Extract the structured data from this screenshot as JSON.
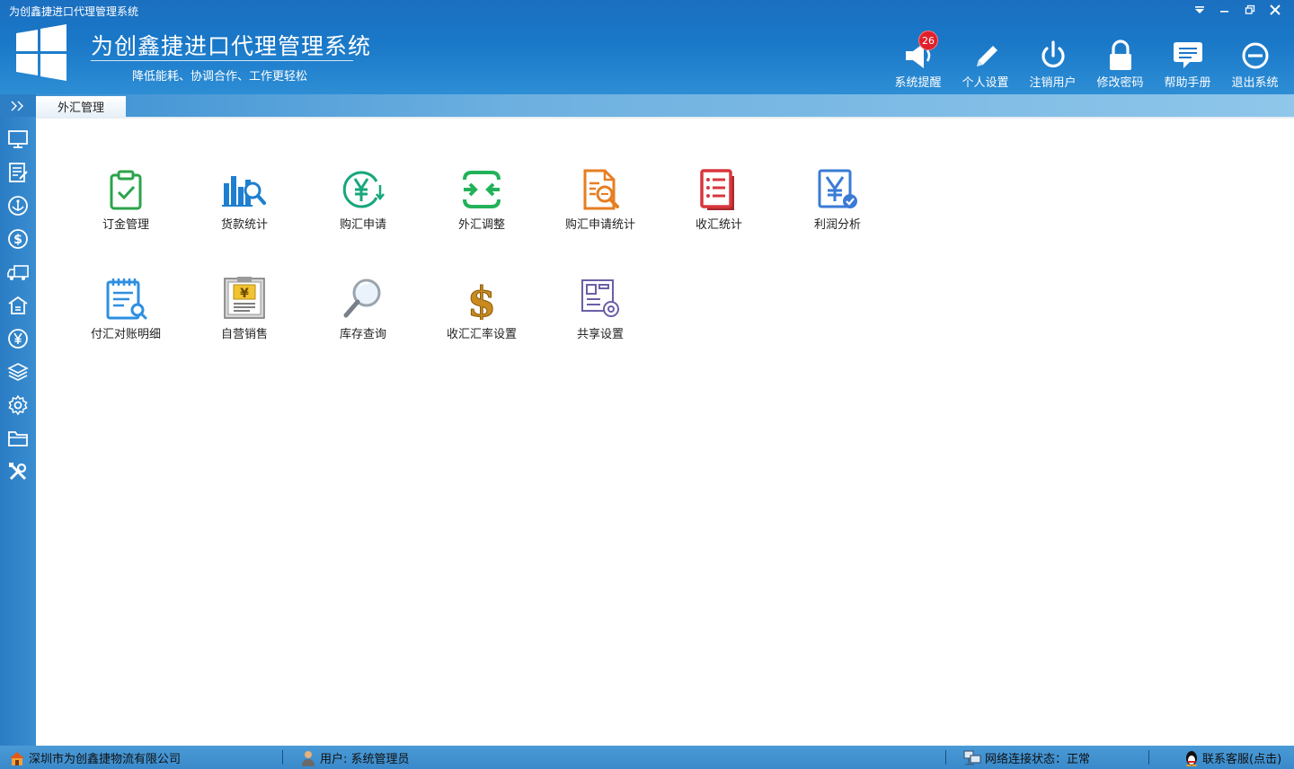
{
  "window": {
    "title": "为创鑫捷进口代理管理系统"
  },
  "header": {
    "app_title": "为创鑫捷进口代理管理系统",
    "slogan": "降低能耗、协调合作、工作更轻松",
    "tools": [
      {
        "label": "系统提醒",
        "icon": "speaker-icon",
        "badge": "26"
      },
      {
        "label": "个人设置",
        "icon": "pencil-icon"
      },
      {
        "label": "注销用户",
        "icon": "power-icon"
      },
      {
        "label": "修改密码",
        "icon": "lock-icon"
      },
      {
        "label": "帮助手册",
        "icon": "chat-icon"
      },
      {
        "label": "退出系统",
        "icon": "exit-icon"
      }
    ]
  },
  "tabbar": {
    "expand": ">>",
    "active_tab": "外汇管理"
  },
  "sidebar": {
    "items": [
      "monitor-icon",
      "checklist-icon",
      "anchor-icon",
      "dollar-icon",
      "truck-icon",
      "warehouse-icon",
      "yen-icon",
      "layers-icon",
      "settings-icon",
      "folder-icon",
      "tools-icon"
    ]
  },
  "modules": [
    {
      "label": "订金管理",
      "icon": "clipboard-check-icon",
      "color": "#2aa44a"
    },
    {
      "label": "货款统计",
      "icon": "bar-chart-search-icon",
      "color": "#1e7fd0"
    },
    {
      "label": "购汇申请",
      "icon": "yen-exchange-icon",
      "color": "#17a77c"
    },
    {
      "label": "外汇调整",
      "icon": "arrows-adjust-icon",
      "color": "#22b25a"
    },
    {
      "label": "购汇申请统计",
      "icon": "document-search-icon",
      "color": "#e67e22"
    },
    {
      "label": "收汇统计",
      "icon": "list-document-icon",
      "color": "#d9363e"
    },
    {
      "label": "利润分析",
      "icon": "yen-check-icon",
      "color": "#3a7bd5"
    },
    {
      "label": "付汇对账明细",
      "icon": "notepad-search-icon",
      "color": "#2f8fe0"
    },
    {
      "label": "自营销售",
      "icon": "yen-certificate-icon",
      "color": "#c99a2e"
    },
    {
      "label": "库存查询",
      "icon": "magnifier-icon",
      "color": "#8a8a8a"
    },
    {
      "label": "收汇汇率设置",
      "icon": "gold-dollar-icon",
      "color": "#c98a1e"
    },
    {
      "label": "共享设置",
      "icon": "layout-gear-icon",
      "color": "#6a5fa8"
    }
  ],
  "status": {
    "company": "深圳市为创鑫捷物流有限公司",
    "user": "用户: 系统管理员",
    "network": "网络连接状态：正常",
    "support": "联系客服(点击)"
  }
}
